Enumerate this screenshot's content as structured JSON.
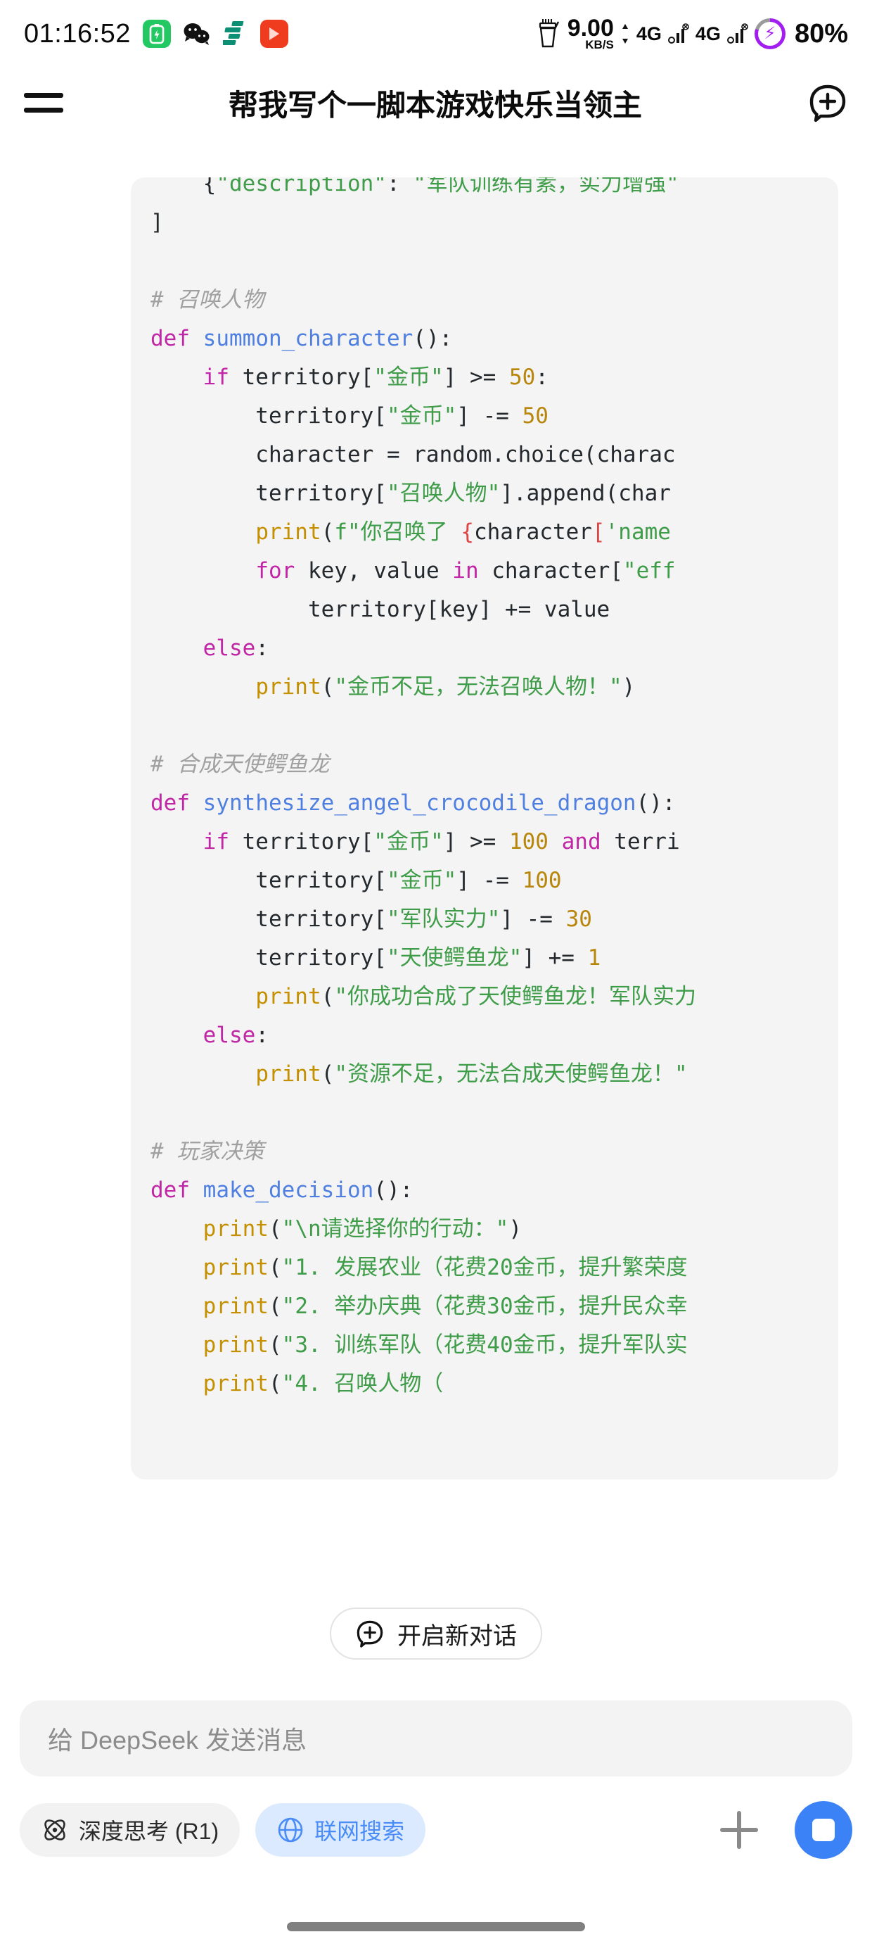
{
  "status_bar": {
    "time": "01:16:52",
    "app_icons": [
      "battery-app-icon",
      "wechat-icon",
      "teal-app-icon",
      "video-play-icon"
    ],
    "network_speed_value": "9.00",
    "network_speed_unit": "KB/S",
    "network_type_1": "4G",
    "network_type_2": "4G",
    "battery_percent": "80%",
    "charging": true,
    "charge_ring_color": "#a21df0",
    "battery_level": 80
  },
  "header": {
    "menu_icon": "hamburger-menu-icon",
    "title": "帮我写个一脚本游戏快乐当领主",
    "new_chat_icon": "new-chat-bubble-plus-icon"
  },
  "code_block": {
    "background": "#f4f4f4",
    "language": "python",
    "colors": {
      "keyword": "#c026a5",
      "function": "#4f7fe0",
      "string": "#3f9c49",
      "number": "#b8860b",
      "comment": "#a0a0a0",
      "builtin": "#c49000",
      "fstring_brace": "#d44444",
      "plain": "#24292e"
    },
    "lines": [
      "    {\"description\": \"军队训练有素，实力增强\"",
      "]",
      "",
      "# 召唤人物",
      "def summon_character():",
      "    if territory[\"金币\"] >= 50:",
      "        territory[\"金币\"] -= 50",
      "        character = random.choice(charac",
      "        territory[\"召唤人物\"].append(char",
      "        print(f\"你召唤了 {character['name",
      "        for key, value in character[\"eff",
      "            territory[key] += value",
      "    else:",
      "        print(\"金币不足，无法召唤人物！\")",
      "",
      "# 合成天使鳄鱼龙",
      "def synthesize_angel_crocodile_dragon():",
      "    if territory[\"金币\"] >= 100 and terri",
      "        territory[\"金币\"] -= 100",
      "        territory[\"军队实力\"] -= 30",
      "        territory[\"天使鳄鱼龙\"] += 1",
      "        print(\"你成功合成了天使鳄鱼龙！军队实力",
      "    else:",
      "        print(\"资源不足，无法合成天使鳄鱼龙！\"",
      "",
      "# 玩家决策",
      "def make_decision():",
      "    print(\"\\n请选择你的行动：\")",
      "    print(\"1. 发展农业（花费20金币，提升繁荣度",
      "    print(\"2. 举办庆典（花费30金币，提升民众幸",
      "    print(\"3. 训练军队（花费40金币，提升军队实",
      "    print(\"4. 召唤人物（"
    ]
  },
  "new_chat_button": {
    "icon": "new-chat-bubble-plus-icon",
    "label": "开启新对话"
  },
  "composer": {
    "placeholder": "给 DeepSeek 发送消息",
    "value": "",
    "deep_think": {
      "icon": "atom-icon",
      "label": "深度思考 (R1)",
      "active": false
    },
    "web_search": {
      "icon": "globe-icon",
      "label": "联网搜索",
      "active": true,
      "accent": "#4a8cf7"
    },
    "attach_icon": "plus-icon",
    "stop_icon": "stop-square-icon",
    "stop_color": "#3b82f6"
  }
}
